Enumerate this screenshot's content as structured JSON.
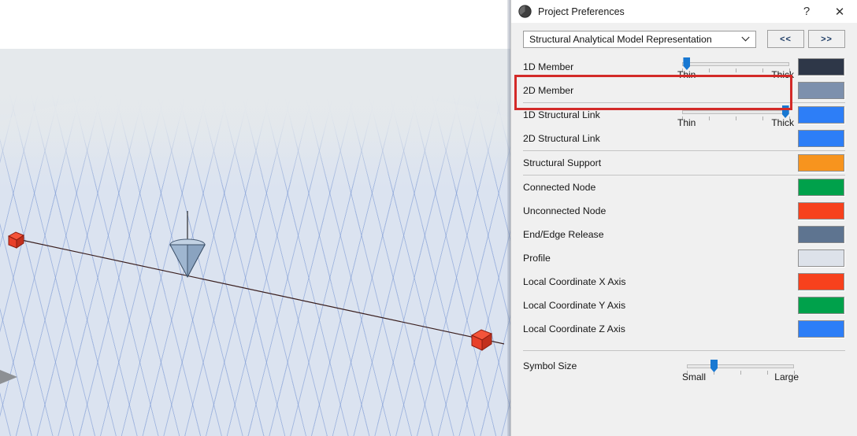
{
  "viewport": {
    "name": "3d-model-viewport",
    "background_sky": "#e5e9ec",
    "ground_color": "#dbe3f0",
    "grid_line_color": "#7a96d2",
    "member_line_color": "#3a1f1f",
    "node_color": "#e8402a",
    "cursor_cone_color": "#a9bdd6"
  },
  "dialog": {
    "title": "Project Preferences",
    "icon": "archicad-sphere-icon",
    "help_label": "?",
    "close_label": "✕",
    "preset": {
      "value": "Structural Analytical Model Representation",
      "dropdown_icon": "chevron-down-icon"
    },
    "nav": {
      "prev_label": "<<",
      "next_label": ">>"
    }
  },
  "rows": [
    {
      "label": "1D Member",
      "has_slider": true,
      "slider": {
        "min_label": "Thin",
        "max_label": "Thick",
        "value_pct": 4
      },
      "color": "#2e3748",
      "highlighted": true
    },
    {
      "label": "2D Member",
      "has_slider": false,
      "color": "#7d90ad"
    },
    {
      "label": "1D Structural Link",
      "has_slider": true,
      "slider": {
        "min_label": "Thin",
        "max_label": "Thick",
        "value_pct": 96
      },
      "color": "#2d7ef7"
    },
    {
      "label": "2D Structural Link",
      "has_slider": false,
      "color": "#2d7ef7"
    },
    {
      "label": "Structural Support",
      "has_slider": false,
      "color": "#f7941e"
    },
    {
      "label": "Connected Node",
      "has_slider": false,
      "color": "#00a14b"
    },
    {
      "label": "Unconnected Node",
      "has_slider": false,
      "color": "#f7411d"
    },
    {
      "label": "End/Edge Release",
      "has_slider": false,
      "color": "#5e7490"
    },
    {
      "label": "Profile",
      "has_slider": false,
      "color": "#dde2ea"
    },
    {
      "label": "Local Coordinate X Axis",
      "has_slider": false,
      "color": "#f7411d"
    },
    {
      "label": "Local Coordinate Y Axis",
      "has_slider": false,
      "color": "#00a14b"
    },
    {
      "label": "Local Coordinate Z Axis",
      "has_slider": false,
      "color": "#2d7ef7"
    }
  ],
  "symbol_size": {
    "label": "Symbol Size",
    "min_label": "Small",
    "max_label": "Large",
    "value_pct": 25
  },
  "highlight": {
    "color": "#d32a28",
    "target": "1D Member"
  }
}
